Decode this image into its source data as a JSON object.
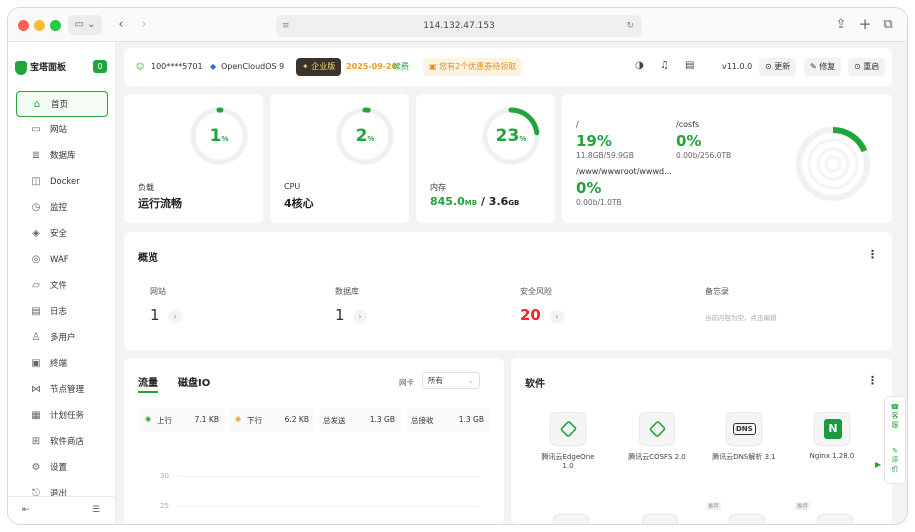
{
  "browser": {
    "url": "114.132.47.153"
  },
  "sidebar": {
    "brand": "宝塔面板",
    "badge": "0",
    "items": [
      {
        "label": "首页",
        "icon": "home-icon"
      },
      {
        "label": "网站",
        "icon": "website-icon"
      },
      {
        "label": "数据库",
        "icon": "database-icon"
      },
      {
        "label": "Docker",
        "icon": "docker-icon"
      },
      {
        "label": "监控",
        "icon": "monitor-icon"
      },
      {
        "label": "安全",
        "icon": "shield-icon"
      },
      {
        "label": "WAF",
        "icon": "waf-icon"
      },
      {
        "label": "文件",
        "icon": "folder-icon"
      },
      {
        "label": "日志",
        "icon": "log-icon"
      },
      {
        "label": "多用户",
        "icon": "users-icon"
      },
      {
        "label": "终端",
        "icon": "terminal-icon"
      },
      {
        "label": "节点管理",
        "icon": "node-icon"
      },
      {
        "label": "计划任务",
        "icon": "calendar-icon"
      },
      {
        "label": "软件商店",
        "icon": "store-icon"
      },
      {
        "label": "设置",
        "icon": "settings-icon"
      },
      {
        "label": "退出",
        "icon": "logout-icon"
      }
    ]
  },
  "topbar": {
    "user": "100****5701",
    "os": "OpenCloudOS 9",
    "edition": "企业版",
    "expiry": "2025-09-20",
    "renew": "续费",
    "coupon": "您有2个优惠券待领取",
    "version": "v11.0.0",
    "update": "更新",
    "repair": "修复",
    "restart": "重启"
  },
  "gauges": [
    {
      "value": "1",
      "unit": "%",
      "percent": 1,
      "label": "负载",
      "status": "运行流畅"
    },
    {
      "value": "2",
      "unit": "%",
      "percent": 2,
      "label": "CPU",
      "status": "4核心"
    },
    {
      "value": "23",
      "unit": "%",
      "percent": 23,
      "label": "内存",
      "used": "845.0",
      "used_unit": "MB",
      "sep": " / ",
      "total": "3.6",
      "total_unit": "GB"
    }
  ],
  "disks": [
    {
      "path": "/",
      "percent": "19%",
      "usage": "11.8GB/59.9GB"
    },
    {
      "path": "/cosfs",
      "percent": "0%",
      "usage": "0.00b/256.0TB"
    },
    {
      "path": "/www/wwwroot/wwwd...",
      "percent": "0%",
      "usage": "0.00b/1.0TB"
    }
  ],
  "overview": {
    "title": "概览",
    "items": [
      {
        "label": "网站",
        "value": "1"
      },
      {
        "label": "数据库",
        "value": "1"
      },
      {
        "label": "安全风险",
        "value": "20"
      },
      {
        "label": "备忘录",
        "value": "当前内容为空，点击编辑"
      }
    ]
  },
  "traffic": {
    "tab_traffic": "流量",
    "tab_disk": "磁盘IO",
    "nic_label": "网卡",
    "nic_value": "所有",
    "stats": [
      {
        "label": "上行",
        "value": "7.1 KB"
      },
      {
        "label": "下行",
        "value": "6.2 KB"
      },
      {
        "label": "总发送",
        "value": "1.3 GB"
      },
      {
        "label": "总接收",
        "value": "1.3 GB"
      }
    ],
    "yticks": [
      "30",
      "25"
    ]
  },
  "software": {
    "title": "软件",
    "items": [
      {
        "name": "腾讯云EdgeOne 1.0",
        "icon": "edgeone-icon"
      },
      {
        "name": "腾讯云COSFS 2.0",
        "icon": "cosfs-icon"
      },
      {
        "name": "腾讯云DNS解析 3.1",
        "icon": "dns-icon"
      },
      {
        "name": "Nginx 1.28.0",
        "icon": "nginx-icon"
      }
    ],
    "recommend": "推荐"
  },
  "float": {
    "service": "客服",
    "review": "评价"
  },
  "colors": {
    "accent": "#20a53a",
    "danger": "#f0232f",
    "warning": "#f39a1d"
  }
}
